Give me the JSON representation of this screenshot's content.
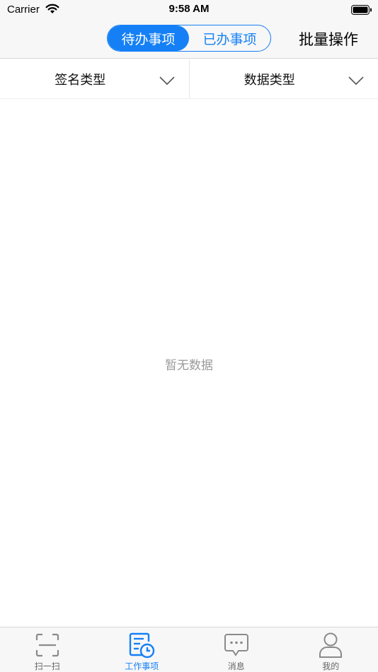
{
  "status_bar": {
    "carrier": "Carrier",
    "time": "9:58 AM"
  },
  "nav": {
    "segments": [
      {
        "label": "待办事项",
        "active": true
      },
      {
        "label": "已办事项",
        "active": false
      }
    ],
    "batch_label": "批量操作"
  },
  "filters": [
    {
      "label": "签名类型"
    },
    {
      "label": "数据类型"
    }
  ],
  "empty_state": {
    "text": "暂无数据"
  },
  "tab_bar": {
    "items": [
      {
        "label": "扫一扫",
        "icon": "scan-icon",
        "active": false
      },
      {
        "label": "工作事项",
        "icon": "task-clock-icon",
        "active": true
      },
      {
        "label": "消息",
        "icon": "message-icon",
        "active": false
      },
      {
        "label": "我的",
        "icon": "user-icon",
        "active": false
      }
    ]
  },
  "colors": {
    "accent": "#1580f5",
    "muted_text": "#9a9a9a",
    "bar_background": "#f7f7f7"
  }
}
